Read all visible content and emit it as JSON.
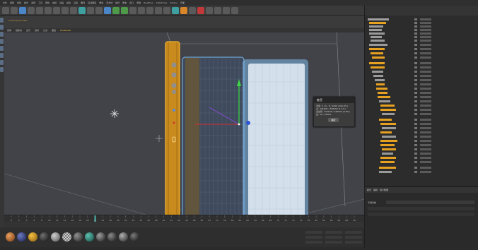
{
  "menubar": {
    "items": [
      "文件",
      "编辑",
      "创建",
      "模式",
      "选择",
      "工具",
      "网格",
      "捕捉",
      "动画",
      "模拟",
      "渲染",
      "雕刻",
      "运动跟踪",
      "角色",
      "流水线",
      "插件",
      "脚本",
      "窗口",
      "帮助",
      "RealFlow",
      "X-Particles",
      "Octane",
      "界面"
    ]
  },
  "viewport": {
    "header_label": "Lorem Ipsum Text",
    "menu": [
      "查看",
      "摄像机",
      "显示",
      "选项",
      "过滤",
      "面板",
      "ProRender"
    ],
    "active_menu": "ProRender"
  },
  "dialog": {
    "title": "信息",
    "close": "×",
    "lines": [
      "对象: 0 / 0 - 8 / 1000 (100.0%)",
      "点: 345600 / 348160 (1.1%)",
      "多边形: 340128 / 348000 (9.8%)",
      "边: 42 / 32000"
    ],
    "ok_label": "确定"
  },
  "timeline": {
    "ticks": [
      "0",
      "2",
      "4",
      "6",
      "8",
      "10",
      "12",
      "14",
      "16",
      "18",
      "20",
      "22",
      "24",
      "26",
      "28",
      "30",
      "32",
      "34",
      "36",
      "38",
      "40",
      "42",
      "44",
      "46",
      "48",
      "50",
      "52",
      "54",
      "56",
      "58",
      "60",
      "62",
      "64",
      "66",
      "68",
      "70",
      "72",
      "74",
      "76",
      "78",
      "80",
      "82",
      "84",
      "86",
      "88",
      "90"
    ]
  },
  "attributes": {
    "tabs": [
      "模式",
      "编辑",
      "用户数据"
    ],
    "field_label": "平滑对象"
  },
  "colors": {
    "accent": "#e6a120",
    "selection": "#5aa9e6",
    "viewport_bg": "#414349"
  }
}
